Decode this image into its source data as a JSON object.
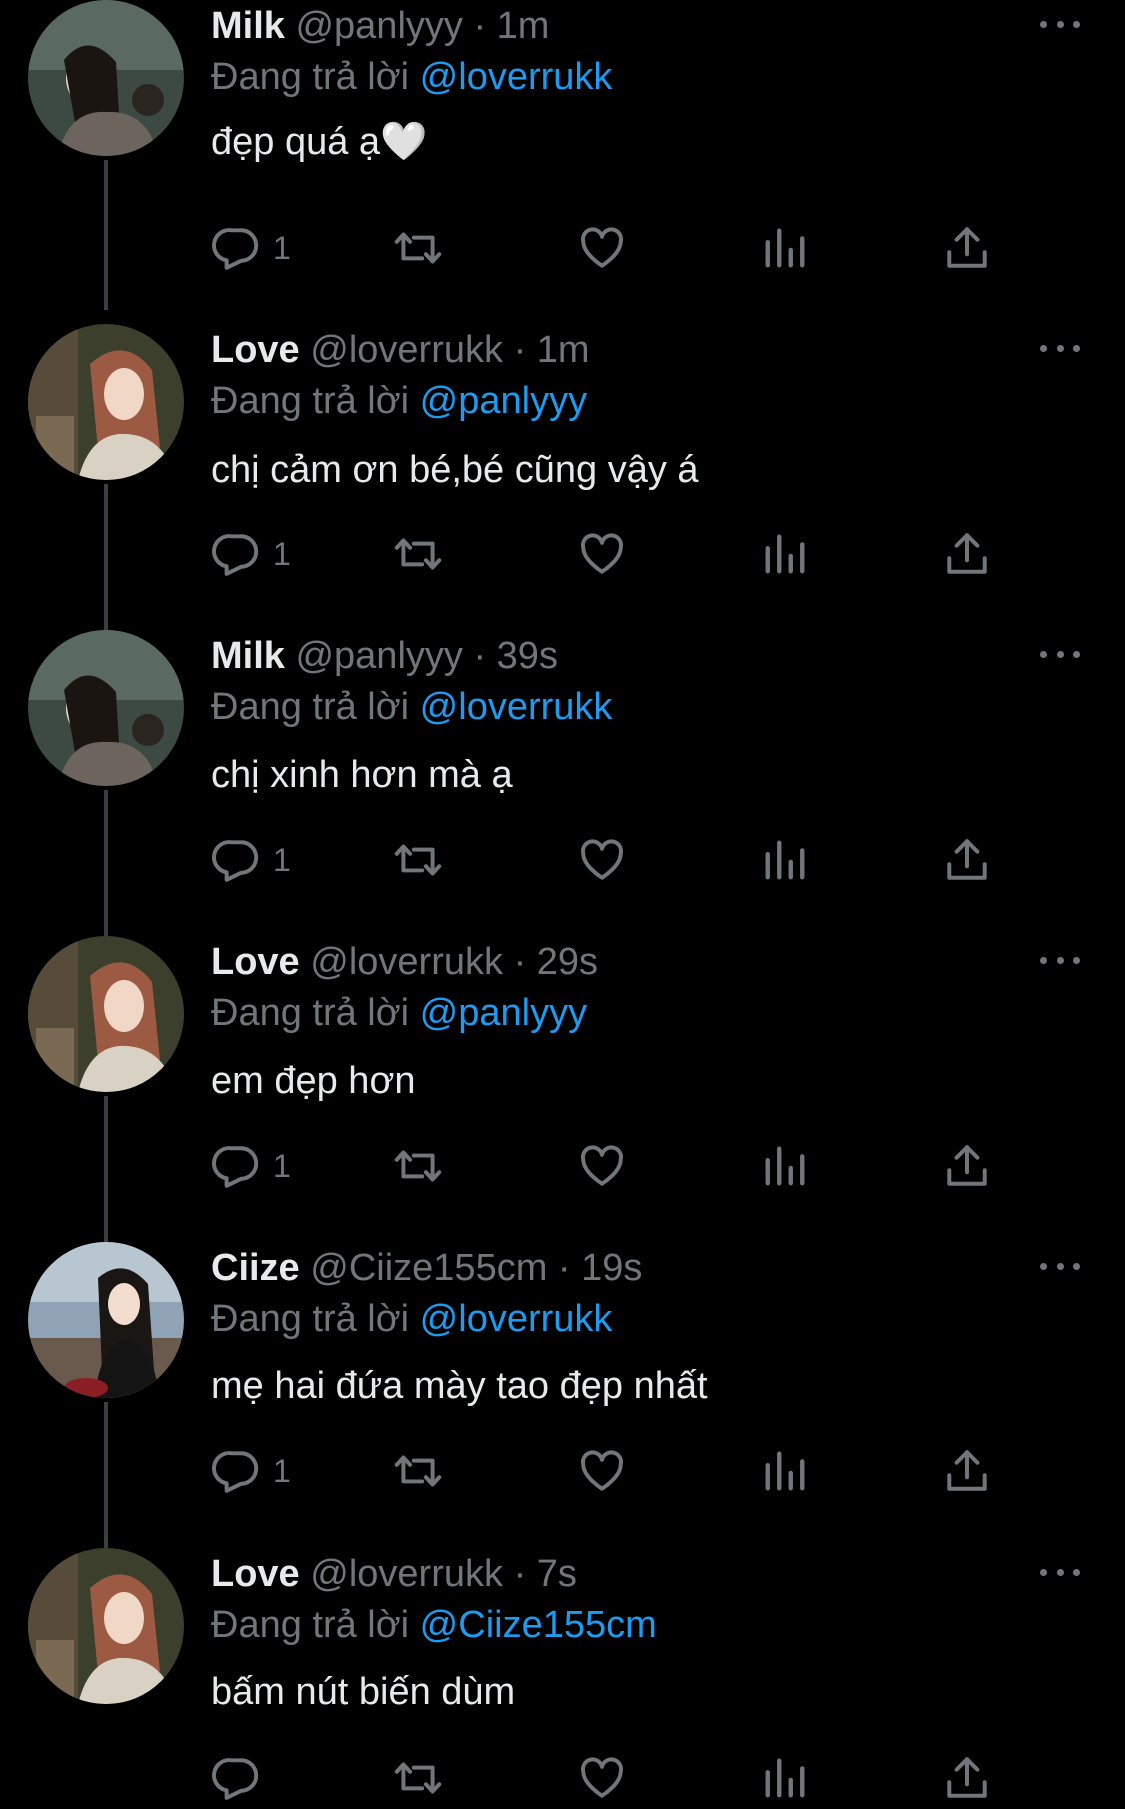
{
  "thread": {
    "reply_prefix": "Đang trả lời",
    "tweets": [
      {
        "name": "Milk",
        "handle": "@panlyyy",
        "dot": "·",
        "time": "1m",
        "reply_to": "@loverrukk",
        "text": "đẹp quá ạ🤍",
        "reply_count": "1",
        "avatar": "milk-avatar"
      },
      {
        "name": "Love",
        "handle": "@loverrukk",
        "dot": "·",
        "time": "1m",
        "reply_to": "@panlyyy",
        "text": "chị cảm ơn bé,bé cũng vậy á",
        "reply_count": "1",
        "avatar": "love-avatar"
      },
      {
        "name": "Milk",
        "handle": "@panlyyy",
        "dot": "·",
        "time": "39s",
        "reply_to": "@loverrukk",
        "text": "chị xinh hơn mà ạ",
        "reply_count": "1",
        "avatar": "milk-avatar"
      },
      {
        "name": "Love",
        "handle": "@loverrukk",
        "dot": "·",
        "time": "29s",
        "reply_to": "@panlyyy",
        "text": "em đẹp hơn",
        "reply_count": "1",
        "avatar": "love-avatar"
      },
      {
        "name": "Ciize",
        "handle": "@Ciize155cm",
        "dot": "·",
        "time": "19s",
        "reply_to": "@loverrukk",
        "text": "mẹ hai đứa mày tao đẹp nhất",
        "reply_count": "1",
        "avatar": "ciize-avatar"
      },
      {
        "name": "Love",
        "handle": "@loverrukk",
        "dot": "·",
        "time": "7s",
        "reply_to": "@Ciize155cm",
        "text": "bấm nút biến dùm",
        "reply_count": "",
        "avatar": "love-avatar"
      }
    ]
  },
  "icons": {
    "reply": "reply-icon",
    "retweet": "retweet-icon",
    "like": "heart-icon",
    "views": "views-icon",
    "share": "share-icon",
    "more": "more-icon"
  },
  "colors": {
    "background": "#000000",
    "text": "#e7e9ea",
    "secondary": "#71767b",
    "accent": "#1d9bf0",
    "thread_line": "#3a3d41"
  }
}
